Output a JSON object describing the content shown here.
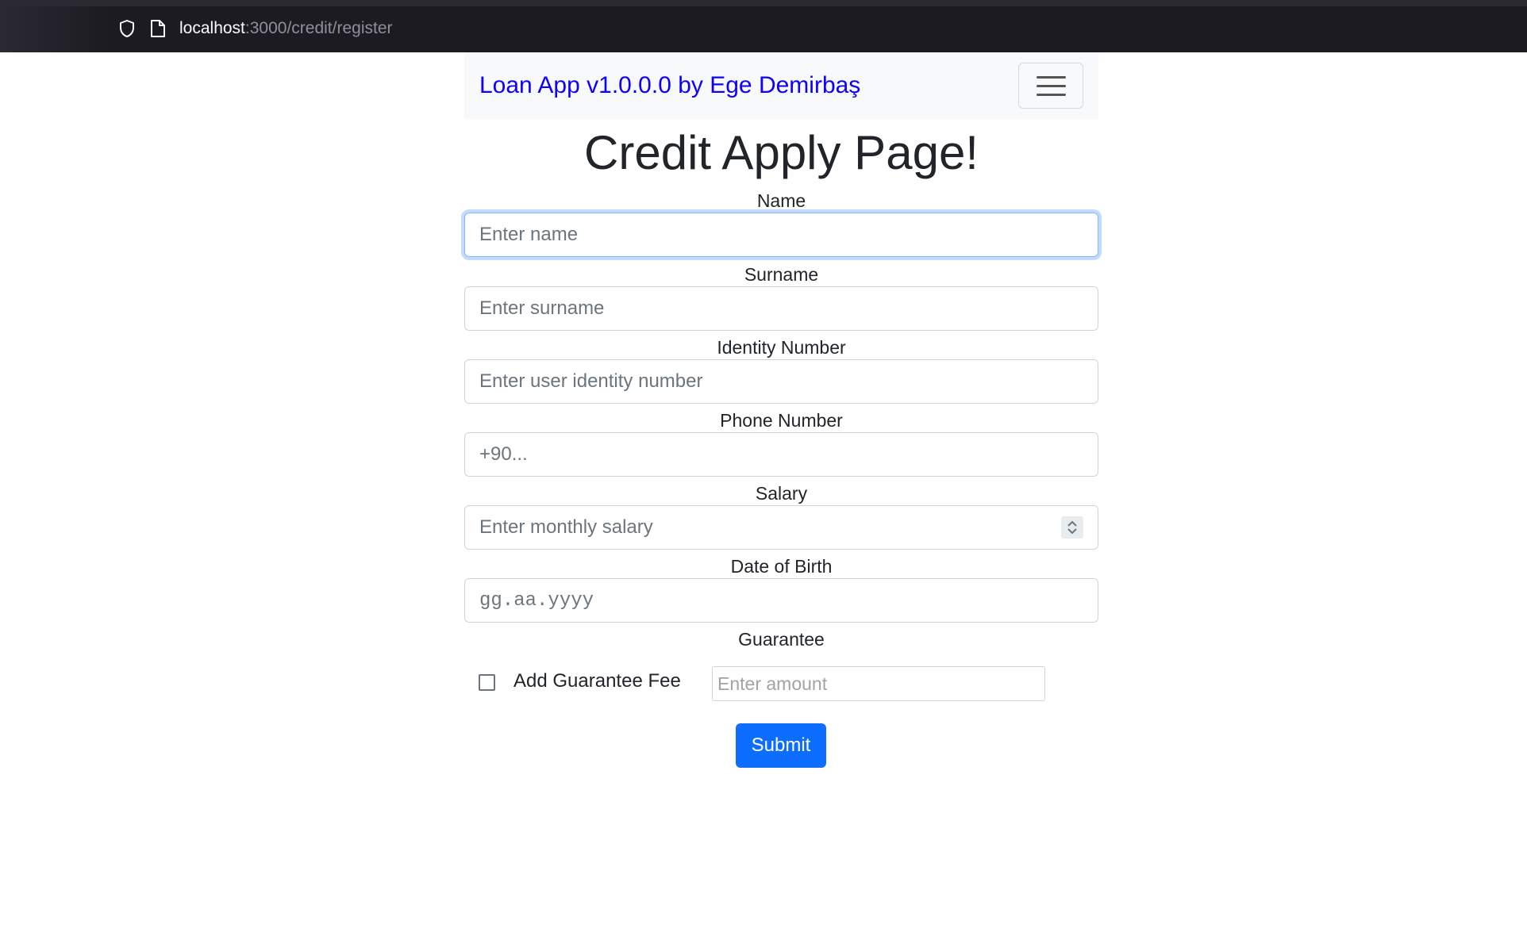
{
  "browser": {
    "url_host": "localhost",
    "url_rest": ":3000/credit/register"
  },
  "navbar": {
    "brand": "Loan App v1.0.0.0 by Ege Demirbaş"
  },
  "page_title": "Credit Apply Page!",
  "form": {
    "name": {
      "label": "Name",
      "placeholder": "Enter name"
    },
    "surname": {
      "label": "Surname",
      "placeholder": "Enter surname"
    },
    "identity": {
      "label": "Identity Number",
      "placeholder": "Enter user identity number"
    },
    "phone": {
      "label": "Phone Number",
      "placeholder": "+90..."
    },
    "salary": {
      "label": "Salary",
      "placeholder": "Enter monthly salary"
    },
    "birth": {
      "label": "Date of Birth",
      "placeholder": "gg.aa.yyyy"
    },
    "guarantee": {
      "label": "Guarantee",
      "checkbox_label": "Add Guarantee Fee",
      "checked": false,
      "amount_placeholder": "Enter amount"
    },
    "submit_label": "Submit"
  },
  "colors": {
    "brand": "#0d00ff",
    "primary": "#0d6efd",
    "focus_ring": "#86b7fe"
  }
}
